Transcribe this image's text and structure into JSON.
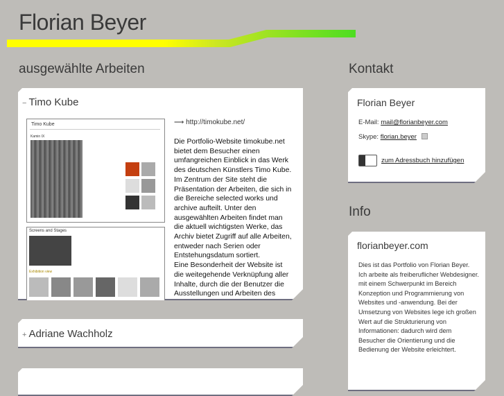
{
  "header": {
    "title": "Florian Beyer"
  },
  "colors": {
    "background": "#bebcb8",
    "bar_start": "#ffff00",
    "bar_end": "#4ddd22"
  },
  "works": {
    "heading": "ausgewählte Arbeiten",
    "items": [
      {
        "toggle": "−",
        "title": "Timo Kube",
        "link": "http://timokube.net/",
        "description": "Die Portfolio-Website timokube.net bietet dem Besucher einen umfangreichen Einblick in das Werk des deutschen Künstlers Timo Kube. Im Zentrum der Site steht die Präsentation der Arbeiten, die sich in die Bereiche selected works und archive aufteilt. Unter den ausgewählten Arbeiten findet man die aktuell wichtigsten Werke, das Archiv bietet Zugriff auf alle Arbeiten, entweder nach Serien oder Entstehungsdatum sortiert.",
        "description2": "Eine Besonderheit der Website ist die weitegehende Verknüpfung aller Inhalte, durch die der Benutzer die Ausstellungen und Arbeiten des",
        "screenshot1_title": "Timo Kube",
        "screenshot1_sub": "Kamin IX",
        "screenshot2_title": "Screens and Stages",
        "screenshot2_sub": "Exhibition view"
      },
      {
        "toggle": "+",
        "title": "Adriane Wachholz"
      }
    ]
  },
  "contact": {
    "heading": "Kontakt",
    "name": "Florian Beyer",
    "email_label": "E-Mail:",
    "email": "mail@florianbeyer.com",
    "skype_label": "Skype:",
    "skype": "florian.beyer",
    "addressbook": "zum Adressbuch hinzufügen"
  },
  "info": {
    "heading": "Info",
    "title": "florianbeyer.com",
    "text": "Dies ist das Portfolio von Florian Beyer. Ich arbeite als freiberuflicher Webdesigner. mit einem Schwerpunkt im Bereich Konzeption und Programmierung von Websites und -anwendung. Bei der Umsetzung von Websites lege ich großen Wert auf die Strukturierung von Informationen: dadurch wird dem Besucher die Orientierung und die Bedienung der Website erleichtert."
  }
}
